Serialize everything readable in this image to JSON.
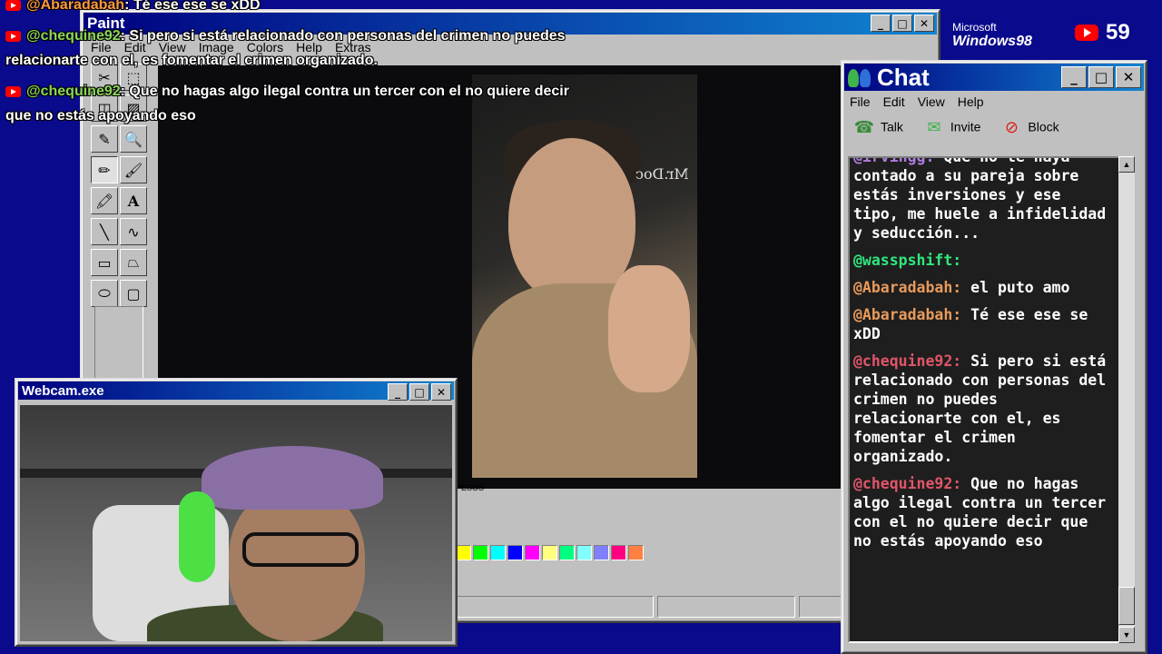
{
  "paint": {
    "title": "Paint",
    "menu": [
      "File",
      "Edit",
      "View",
      "Image",
      "Colors",
      "Help",
      "Extras"
    ],
    "tools": [
      "✂",
      "⬚",
      "◫",
      "▨",
      "✎",
      "🔍",
      "✏",
      "🖌",
      "🖍",
      "A",
      "╲",
      "∿",
      "▭",
      "⏢",
      "⬭",
      "▢"
    ],
    "video_logo": "Mr.Doc",
    "canvas_caption": "PESOS",
    "palette": [
      "#ffff00",
      "#00ff00",
      "#00ffff",
      "#0000ff",
      "#ff00ff",
      "#ffff80",
      "#00ff80",
      "#80ffff",
      "#8080ff",
      "#ff0080",
      "#ff8040"
    ]
  },
  "windows_logo": {
    "brand": "Microsoft",
    "product": "Windows98"
  },
  "youtube": {
    "count": "59"
  },
  "chat": {
    "title": "Chat",
    "menu": [
      "File",
      "Edit",
      "View",
      "Help"
    ],
    "tools": [
      {
        "icon": "talk-icon",
        "label": "Talk"
      },
      {
        "icon": "invite-icon",
        "label": "Invite"
      },
      {
        "icon": "block-icon",
        "label": "Block"
      }
    ],
    "messages": [
      {
        "user": "@irvingg:",
        "color": "#b07de0",
        "text": "Que no le haya contado a su pareja sobre estás inversiones y ese tipo, me huele a infidelidad y seducción..."
      },
      {
        "user": "@wasspshift:",
        "color": "#2ee87e",
        "text": ""
      },
      {
        "user": "@Abaradabah:",
        "color": "#e89a5b",
        "text": "el puto amo"
      },
      {
        "user": "@Abaradabah:",
        "color": "#e89a5b",
        "text": "Té ese ese se xDD"
      },
      {
        "user": "@chequine92:",
        "color": "#e0566a",
        "text": "Si pero si está relacionado con personas del crimen no puedes relacionarte con el, es fomentar el crimen organizado."
      },
      {
        "user": "@chequine92:",
        "color": "#e0566a",
        "text": "Que no hagas algo ilegal contra un tercer con el no quiere decir que no estás apoyando eso"
      }
    ]
  },
  "webcam": {
    "title": "Webcam.exe"
  },
  "overlay": [
    {
      "user": "@Abaradabah",
      "text": ": Té ese ese se xDD",
      "user_class": "orange"
    },
    {
      "user": "@chequine92",
      "text": ": Si pero si está relacionado con personas del crimen no puedes",
      "user_class": ""
    },
    {
      "user": "",
      "text": "relacionarte con el, es fomentar el crimen organizado.",
      "user_class": ""
    },
    {
      "user": "@chequine92",
      "text": ": Que no hagas algo ilegal contra un tercer con el no quiere decir",
      "user_class": ""
    },
    {
      "user": "",
      "text": "que no estás apoyando eso",
      "user_class": ""
    }
  ],
  "titlebar_buttons": [
    "_",
    "□",
    "✕"
  ]
}
